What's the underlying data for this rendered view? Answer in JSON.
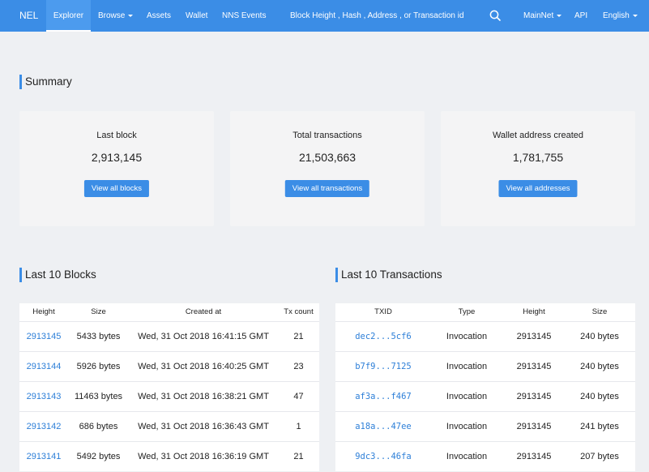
{
  "nav": {
    "brand": "NEL",
    "explorer": "Explorer",
    "browse": "Browse",
    "assets": "Assets",
    "wallet": "Wallet",
    "nns_events": "NNS Events",
    "search_placeholder": "Block Height , Hash , Address , or Transaction id",
    "network": "MainNet",
    "api": "API",
    "language": "English"
  },
  "summary": {
    "title": "Summary",
    "cards": [
      {
        "label": "Last block",
        "value": "2,913,145",
        "button": "View all blocks"
      },
      {
        "label": "Total transactions",
        "value": "21,503,663",
        "button": "View all transactions"
      },
      {
        "label": "Wallet address created",
        "value": "1,781,755",
        "button": "View all addresses"
      }
    ]
  },
  "blocks": {
    "title": "Last 10 Blocks",
    "headers": [
      "Height",
      "Size",
      "Created at",
      "Tx count"
    ],
    "rows": [
      {
        "height": "2913145",
        "size": "5433 bytes",
        "created": "Wed, 31 Oct 2018 16:41:15 GMT",
        "tx": "21"
      },
      {
        "height": "2913144",
        "size": "5926 bytes",
        "created": "Wed, 31 Oct 2018 16:40:25 GMT",
        "tx": "23"
      },
      {
        "height": "2913143",
        "size": "11463 bytes",
        "created": "Wed, 31 Oct 2018 16:38:21 GMT",
        "tx": "47"
      },
      {
        "height": "2913142",
        "size": "686 bytes",
        "created": "Wed, 31 Oct 2018 16:36:43 GMT",
        "tx": "1"
      },
      {
        "height": "2913141",
        "size": "5492 bytes",
        "created": "Wed, 31 Oct 2018 16:36:19 GMT",
        "tx": "21"
      }
    ]
  },
  "transactions": {
    "title": "Last 10 Transactions",
    "headers": [
      "TXID",
      "Type",
      "Height",
      "Size"
    ],
    "rows": [
      {
        "txid": "dec2...5cf6",
        "type": "Invocation",
        "height": "2913145",
        "size": "240 bytes"
      },
      {
        "txid": "b7f9...7125",
        "type": "Invocation",
        "height": "2913145",
        "size": "240 bytes"
      },
      {
        "txid": "af3a...f467",
        "type": "Invocation",
        "height": "2913145",
        "size": "240 bytes"
      },
      {
        "txid": "a18a...47ee",
        "type": "Invocation",
        "height": "2913145",
        "size": "241 bytes"
      },
      {
        "txid": "9dc3...46fa",
        "type": "Invocation",
        "height": "2913145",
        "size": "207 bytes"
      }
    ]
  },
  "colors": {
    "accent": "#3b8de6",
    "link": "#2d7fd8",
    "background": "#eef0f3",
    "card": "#f4f4f5"
  }
}
